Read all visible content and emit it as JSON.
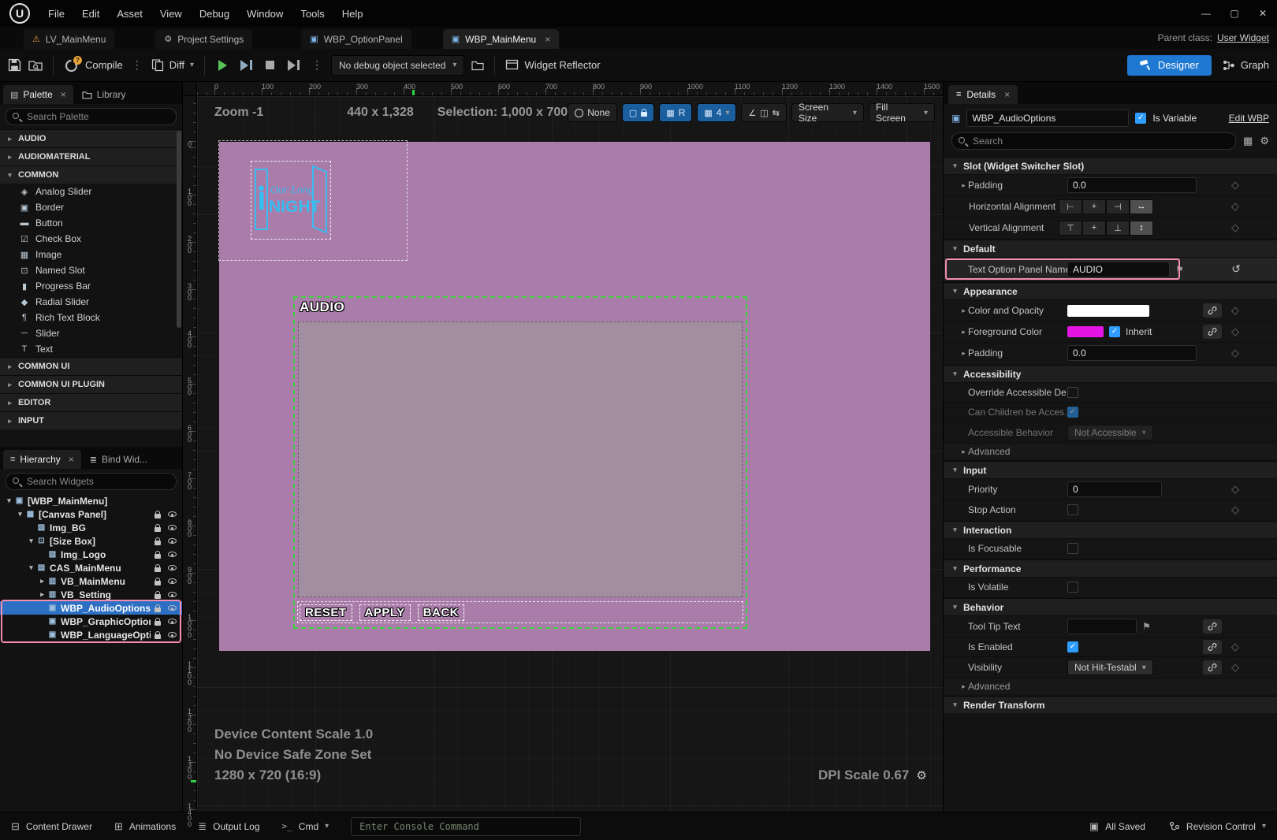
{
  "icons": {
    "unreal": "U",
    "minimize": "—",
    "maximize": "▢",
    "close": "✕",
    "tab_close": "×",
    "warning": "⚠",
    "gear": "⚙",
    "widget": "▣",
    "palette": "▤",
    "lines": "≡",
    "kebab": "⋮",
    "down": "▾",
    "right": "▸",
    "grid": "▦",
    "list": "≣",
    "diamond": "◇",
    "flag": "⚑",
    "revert": "↺",
    "check": "✓",
    "question": "?",
    "angle": "∠",
    "split": "◫",
    "swap": "⇆",
    "drawer": "⊟",
    "anim": "⊞",
    "cmd": ">_"
  },
  "menubar": {
    "items": [
      "File",
      "Edit",
      "Asset",
      "View",
      "Debug",
      "Window",
      "Tools",
      "Help"
    ]
  },
  "tabbar": {
    "tabs": [
      "LV_MainMenu",
      "Project Settings",
      "WBP_OptionPanel",
      "WBP_MainMenu"
    ],
    "parent_label": "Parent class:",
    "parent_value": "User Widget"
  },
  "toolbar": {
    "compile": "Compile",
    "diff": "Diff",
    "debug": "No debug object selected",
    "reflector": "Widget Reflector",
    "designer": "Designer",
    "graph": "Graph"
  },
  "palette": {
    "tab_palette": "Palette",
    "tab_library": "Library",
    "search_placeholder": "Search Palette",
    "cats": [
      "AUDIO",
      "AUDIOMATERIAL",
      "COMMON",
      "COMMON UI",
      "COMMON UI PLUGIN",
      "EDITOR",
      "INPUT"
    ],
    "items": [
      {
        "label": "Analog Slider",
        "glyph": "◈"
      },
      {
        "label": "Border",
        "glyph": "▣"
      },
      {
        "label": "Button",
        "glyph": "▬"
      },
      {
        "label": "Check Box",
        "glyph": "☑"
      },
      {
        "label": "Image",
        "glyph": "▦"
      },
      {
        "label": "Named Slot",
        "glyph": "⊡"
      },
      {
        "label": "Progress Bar",
        "glyph": "▮"
      },
      {
        "label": "Radial Slider",
        "glyph": "◆"
      },
      {
        "label": "Rich Text Block",
        "glyph": "¶"
      },
      {
        "label": "Slider",
        "glyph": "─"
      },
      {
        "label": "Text",
        "glyph": "T"
      }
    ]
  },
  "hierarchy": {
    "tab_hierarchy": "Hierarchy",
    "tab_bind": "Bind Wid...",
    "search_placeholder": "Search Widgets",
    "rows": [
      {
        "label": "[WBP_MainMenu]",
        "arrow": "▾",
        "glyph": "▣"
      },
      {
        "label": "[Canvas Panel]",
        "arrow": "▾",
        "glyph": "▦"
      },
      {
        "label": "Img_BG",
        "arrow": "",
        "glyph": "▨"
      },
      {
        "label": "[Size Box]",
        "arrow": "▾",
        "glyph": "⊡"
      },
      {
        "label": "Img_Logo",
        "arrow": "",
        "glyph": "▨"
      },
      {
        "label": "CAS_MainMenu",
        "arrow": "▾",
        "glyph": "▤"
      },
      {
        "label": "VB_MainMenu",
        "arrow": "▸",
        "glyph": "▥"
      },
      {
        "label": "VB_Setting",
        "arrow": "▸",
        "glyph": "▥"
      },
      {
        "label": "WBP_AudioOptions",
        "arrow": "",
        "glyph": "▣"
      },
      {
        "label": "WBP_GraphicOptions",
        "arrow": "",
        "glyph": "▣"
      },
      {
        "label": "WBP_LanguageOption",
        "arrow": "",
        "glyph": "▣"
      }
    ]
  },
  "canvas": {
    "zoom": "Zoom -1",
    "dims": "440 x 1,328",
    "selection": "Selection: 1,000 x 700",
    "none": "None",
    "r": "R",
    "snap": "4",
    "screen_size": "Screen Size",
    "fill_screen": "Fill Screen",
    "ruler_h": [
      "0",
      "100",
      "200",
      "300",
      "400",
      "500",
      "600",
      "700",
      "800",
      "900",
      "1000",
      "1100",
      "1200",
      "1300",
      "1400",
      "1500"
    ],
    "ruler_v": [
      "0",
      "100",
      "200",
      "300",
      "400",
      "500",
      "600",
      "700",
      "800",
      "900",
      "1000",
      "1100",
      "1200",
      "1300",
      "1400"
    ],
    "logo_line1": "Our Long",
    "logo_line2": "NIGHT",
    "audio_title": "AUDIO",
    "btn_reset": "RESET",
    "btn_apply": "APPLY",
    "btn_back": "BACK",
    "device_scale": "Device Content Scale 1.0",
    "safe_zone": "No Device Safe Zone Set",
    "resolution": "1280 x 720 (16:9)",
    "dpi": "DPI Scale 0.67"
  },
  "details": {
    "tab": "Details",
    "name_value": "WBP_AudioOptions",
    "is_variable": "Is Variable",
    "edit_link": "Edit WBP",
    "search_placeholder": "Search",
    "sec_slot": "Slot (Widget Switcher Slot)",
    "row_padding": "Padding",
    "padding_value": "0.0",
    "row_halign": "Horizontal Alignment",
    "row_valign": "Vertical Alignment",
    "align_h": [
      "⊢",
      "+",
      "⊣",
      "↔"
    ],
    "align_v": [
      "⊤",
      "+",
      "⊥",
      "↕"
    ],
    "sec_default": "Default",
    "row_text_option": "Text Option Panel Name",
    "text_option_value": "AUDIO",
    "sec_appearance": "Appearance",
    "row_color_opacity": "Color and Opacity",
    "row_foreground": "Foreground Color",
    "inherit": "Inherit",
    "row_padding2": "Padding",
    "padding2_value": "0.0",
    "sec_accessibility": "Accessibility",
    "row_override_acc": "Override Accessible De...",
    "row_children_acc": "Can Children be Acces...",
    "row_acc_behavior": "Accessible Behavior",
    "acc_behavior_value": "Not Accessible",
    "advanced": "Advanced",
    "sec_input": "Input",
    "row_priority": "Priority",
    "priority_value": "0",
    "row_stop_action": "Stop Action",
    "sec_interaction": "Interaction",
    "row_is_focusable": "Is Focusable",
    "sec_performance": "Performance",
    "row_is_volatile": "Is Volatile",
    "sec_behavior": "Behavior",
    "row_tooltip": "Tool Tip Text",
    "row_is_enabled": "Is Enabled",
    "row_visibility": "Visibility",
    "visibility_value": "Not Hit-Testabl",
    "sec_render": "Render Transform"
  },
  "statusbar": {
    "content_drawer": "Content Drawer",
    "animations": "Animations",
    "output_log": "Output Log",
    "cmd": "Cmd",
    "console_placeholder": "Enter Console Command",
    "all_saved": "All Saved",
    "revision": "Revision Control"
  }
}
